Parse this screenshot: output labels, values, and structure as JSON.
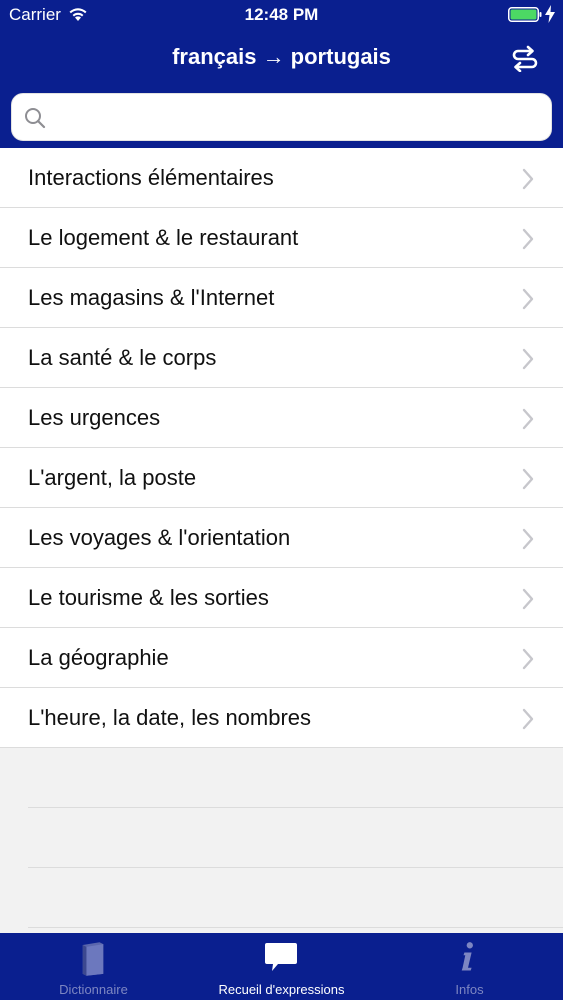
{
  "status_bar": {
    "carrier": "Carrier",
    "time": "12:48 PM"
  },
  "nav": {
    "title": "français → portugais",
    "swap_icon": "swap-arrows-icon"
  },
  "search": {
    "value": "",
    "placeholder": ""
  },
  "categories": [
    {
      "label": "Interactions élémentaires"
    },
    {
      "label": "Le logement & le restaurant"
    },
    {
      "label": "Les magasins & l'Internet"
    },
    {
      "label": "La santé & le corps"
    },
    {
      "label": "Les urgences"
    },
    {
      "label": "L'argent, la poste"
    },
    {
      "label": "Les voyages & l'orientation"
    },
    {
      "label": "Le tourisme & les sorties"
    },
    {
      "label": "La géographie"
    },
    {
      "label": "L'heure, la date, les nombres"
    }
  ],
  "tab_bar": {
    "tabs": [
      {
        "label": "Dictionnaire",
        "icon": "book-icon",
        "active": false
      },
      {
        "label": "Recueil d'expressions",
        "icon": "speech-bubble-icon",
        "active": true
      },
      {
        "label": "Infos",
        "icon": "info-icon",
        "active": false
      }
    ]
  },
  "colors": {
    "brand": "#0a1f8f",
    "battery": "#4cd964"
  }
}
